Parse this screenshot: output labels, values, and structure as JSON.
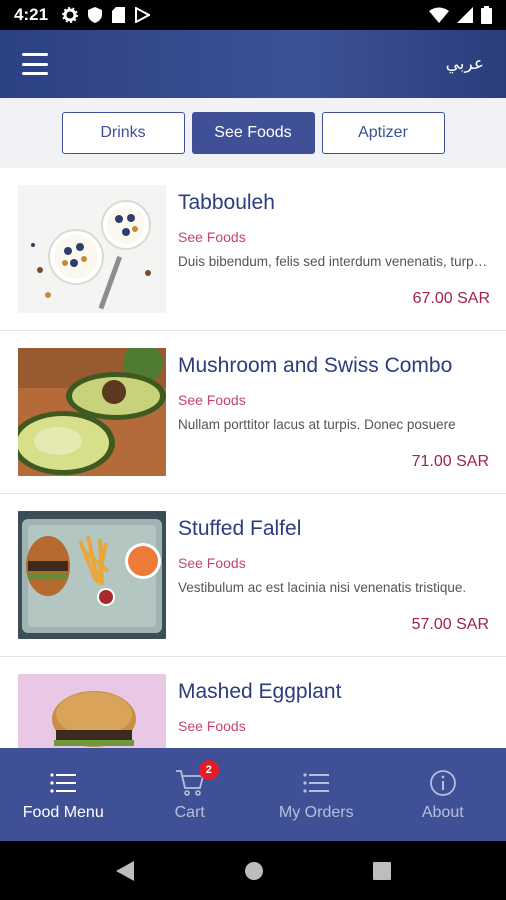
{
  "status_bar": {
    "time": "4:21"
  },
  "app_bar": {
    "language_toggle": "عربي"
  },
  "tabs": [
    {
      "label": "Drinks",
      "active": false
    },
    {
      "label": "See Foods",
      "active": true
    },
    {
      "label": "Aptizer",
      "active": false
    }
  ],
  "items": [
    {
      "title": "Tabbouleh",
      "category": "See Foods",
      "description": "Duis bibendum, felis sed interdum venenatis, turpis enim",
      "price": "67.00 SAR"
    },
    {
      "title": "Mushroom and Swiss Combo",
      "category": "See Foods",
      "description": "Nullam porttitor lacus at turpis. Donec posuere",
      "price": "71.00 SAR"
    },
    {
      "title": "Stuffed Falfel",
      "category": "See Foods",
      "description": "Vestibulum ac est lacinia nisi venenatis tristique.",
      "price": "57.00 SAR"
    },
    {
      "title": "Mashed Eggplant",
      "category": "See Foods",
      "description": "",
      "price": ""
    }
  ],
  "bottom_nav": [
    {
      "label": "Food Menu",
      "icon": "list-icon",
      "active": true
    },
    {
      "label": "Cart",
      "icon": "cart-icon",
      "badge": "2",
      "active": false
    },
    {
      "label": "My Orders",
      "icon": "list-icon",
      "active": false
    },
    {
      "label": "About",
      "icon": "info-icon",
      "active": false
    }
  ],
  "colors": {
    "primary": "#3f5096",
    "accent_pink": "#c6446a",
    "price": "#a0224e",
    "badge": "#e51c23"
  }
}
